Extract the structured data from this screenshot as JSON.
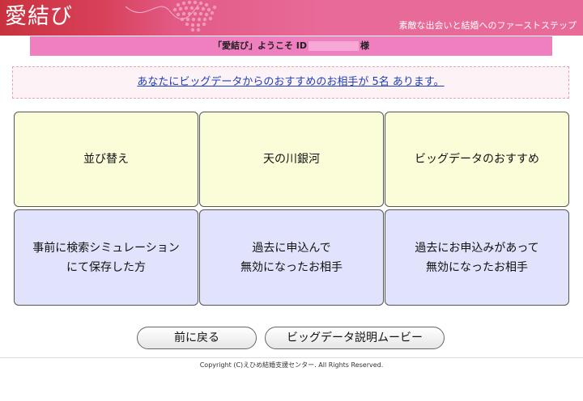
{
  "header": {
    "logo": "愛結び",
    "tagline": "素敵な出会いと結婚へのファーストステップ"
  },
  "welcome": {
    "prefix": "「愛結び」ようこそ ID",
    "suffix": "様"
  },
  "notice": {
    "link_text": "あなたにビッグデータからのおすすめのお相手が 5名 あります。"
  },
  "tiles": [
    {
      "line1": "並び替え",
      "line2": ""
    },
    {
      "line1": "天の川銀河",
      "line2": ""
    },
    {
      "line1": "ビッグデータのおすすめ",
      "line2": ""
    },
    {
      "line1": "事前に検索シミュレーション",
      "line2": "にて保存した方"
    },
    {
      "line1": "過去に申込んで",
      "line2": "無効になったお相手"
    },
    {
      "line1": "過去にお申込みがあって",
      "line2": "無効になったお相手"
    }
  ],
  "buttons": {
    "back": "前に戻る",
    "movie": "ビッグデータ説明ムービー"
  },
  "footer": {
    "copyright": "Copyright (C)えひめ結婚支援センター. All Rights Reserved."
  },
  "colors": {
    "header": "#e86a98",
    "welcome_bar": "#f07fc0",
    "tile_yellow": "#fbfdd8",
    "tile_blue": "#e0e3fb",
    "link": "#1a3fb8"
  }
}
